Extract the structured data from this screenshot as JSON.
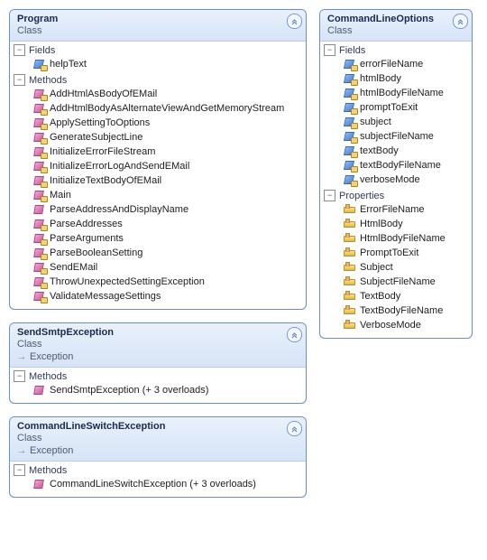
{
  "kinds": {
    "class": "Class"
  },
  "sections": {
    "fields": "Fields",
    "methods": "Methods",
    "properties": "Properties"
  },
  "boxes": {
    "program": {
      "name": "Program",
      "kind": "class",
      "sections": [
        {
          "type": "fields",
          "members": [
            {
              "name": "helpText",
              "icon": "field",
              "priv": true
            }
          ]
        },
        {
          "type": "methods",
          "members": [
            {
              "name": "AddHtmlAsBodyOfEMail",
              "icon": "method",
              "priv": true
            },
            {
              "name": "AddHtmlBodyAsAlternateViewAndGetMemoryStream",
              "icon": "method",
              "priv": true
            },
            {
              "name": "ApplySettingToOptions",
              "icon": "method",
              "priv": true
            },
            {
              "name": "GenerateSubjectLine",
              "icon": "method",
              "priv": true
            },
            {
              "name": "InitializeErrorFileStream",
              "icon": "method",
              "priv": true
            },
            {
              "name": "InitializeErrorLogAndSendEMail",
              "icon": "method",
              "priv": true
            },
            {
              "name": "InitializeTextBodyOfEMail",
              "icon": "method",
              "priv": true
            },
            {
              "name": "Main",
              "icon": "method",
              "priv": true
            },
            {
              "name": "ParseAddressAndDisplayName",
              "icon": "method",
              "priv": false
            },
            {
              "name": "ParseAddresses",
              "icon": "method",
              "priv": true
            },
            {
              "name": "ParseArguments",
              "icon": "method",
              "priv": true
            },
            {
              "name": "ParseBooleanSetting",
              "icon": "method",
              "priv": true
            },
            {
              "name": "SendEMail",
              "icon": "method",
              "priv": true
            },
            {
              "name": "ThrowUnexpectedSettingException",
              "icon": "method",
              "priv": true
            },
            {
              "name": "ValidateMessageSettings",
              "icon": "method",
              "priv": true
            }
          ]
        }
      ]
    },
    "cmdlineoptions": {
      "name": "CommandLineOptions",
      "kind": "class",
      "sections": [
        {
          "type": "fields",
          "members": [
            {
              "name": "errorFileName",
              "icon": "field",
              "priv": true
            },
            {
              "name": "htmlBody",
              "icon": "field",
              "priv": true
            },
            {
              "name": "htmlBodyFileName",
              "icon": "field",
              "priv": true
            },
            {
              "name": "promptToExit",
              "icon": "field",
              "priv": true
            },
            {
              "name": "subject",
              "icon": "field",
              "priv": true
            },
            {
              "name": "subjectFileName",
              "icon": "field",
              "priv": true
            },
            {
              "name": "textBody",
              "icon": "field",
              "priv": true
            },
            {
              "name": "textBodyFileName",
              "icon": "field",
              "priv": true
            },
            {
              "name": "verboseMode",
              "icon": "field",
              "priv": true
            }
          ]
        },
        {
          "type": "properties",
          "members": [
            {
              "name": "ErrorFileName",
              "icon": "property"
            },
            {
              "name": "HtmlBody",
              "icon": "property"
            },
            {
              "name": "HtmlBodyFileName",
              "icon": "property"
            },
            {
              "name": "PromptToExit",
              "icon": "property"
            },
            {
              "name": "Subject",
              "icon": "property"
            },
            {
              "name": "SubjectFileName",
              "icon": "property"
            },
            {
              "name": "TextBody",
              "icon": "property"
            },
            {
              "name": "TextBodyFileName",
              "icon": "property"
            },
            {
              "name": "VerboseMode",
              "icon": "property"
            }
          ]
        }
      ]
    },
    "sendsmtpex": {
      "name": "SendSmtpException",
      "kind": "class",
      "inherits": "Exception",
      "sections": [
        {
          "type": "methods",
          "members": [
            {
              "name": "SendSmtpException (+ 3 overloads)",
              "icon": "method",
              "priv": false
            }
          ]
        }
      ]
    },
    "cmdlineswex": {
      "name": "CommandLineSwitchException",
      "kind": "class",
      "inherits": "Exception",
      "sections": [
        {
          "type": "methods",
          "members": [
            {
              "name": "CommandLineSwitchException (+ 3 overloads)",
              "icon": "method",
              "priv": false
            }
          ]
        }
      ]
    }
  },
  "columns": {
    "left": [
      "program",
      "sendsmtpex",
      "cmdlineswex"
    ],
    "right": [
      "cmdlineoptions"
    ]
  }
}
